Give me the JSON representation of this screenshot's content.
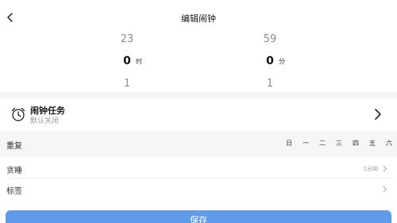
{
  "header": {
    "title": "编辑闹钟",
    "back_icon": "chevron-left-icon"
  },
  "picker": {
    "hour": {
      "prev": "23",
      "current": "0",
      "next": "1",
      "unit": "时"
    },
    "minute": {
      "prev": "59",
      "current": "0",
      "next": "1",
      "unit": "分"
    }
  },
  "alarm_task": {
    "title": "闹钟任务",
    "subtitle": "默认关闭",
    "icon": "alarm-clock-icon"
  },
  "repeat": {
    "label": "重复",
    "days": [
      "日",
      "一",
      "二",
      "三",
      "四",
      "五",
      "六"
    ]
  },
  "snooze": {
    "label": "贪睡",
    "value": "1分钟"
  },
  "tag": {
    "label": "标签"
  },
  "save_label": "保存",
  "colors": {
    "accent": "#5f9bea",
    "section_bg": "#f6f6f6"
  }
}
